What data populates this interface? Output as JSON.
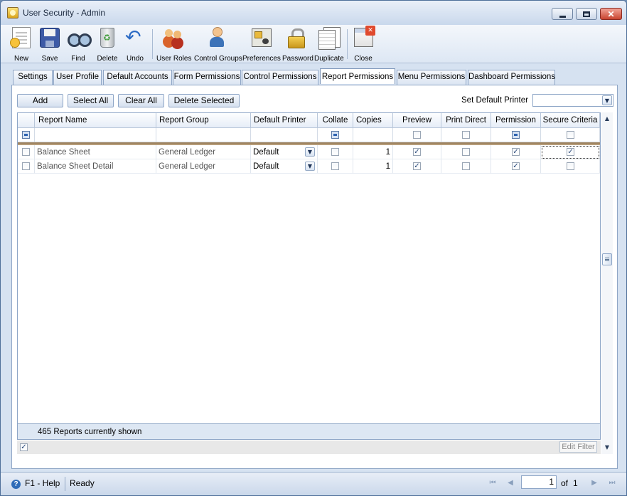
{
  "window": {
    "title": "User Security - Admin"
  },
  "toolbar": {
    "new": "New",
    "save": "Save",
    "find": "Find",
    "delete": "Delete",
    "undo": "Undo",
    "user_roles": "User Roles",
    "control_groups": "Control Groups",
    "preferences": "Preferences",
    "password": "Password",
    "duplicate": "Duplicate",
    "close": "Close"
  },
  "tabs": [
    "Settings",
    "User Profile",
    "Default Accounts",
    "Form Permissions",
    "Control Permissions",
    "Report Permissions",
    "Menu Permissions",
    "Dashboard Permissions"
  ],
  "active_tab": "Report Permissions",
  "actions": {
    "add": "Add",
    "select_all": "Select All",
    "clear_all": "Clear All",
    "delete_selected": "Delete Selected"
  },
  "default_printer": {
    "label": "Set Default Printer",
    "value": ""
  },
  "grid": {
    "columns": [
      "Report Name",
      "Report Group",
      "Default Printer",
      "Collate",
      "Copies",
      "Preview",
      "Print Direct",
      "Permission",
      "Secure Criteria"
    ],
    "rows": [
      {
        "name": "Balance Sheet",
        "group": "General Ledger",
        "printer": "Default",
        "collate": false,
        "copies": "1",
        "preview": true,
        "print_direct": false,
        "permission": true,
        "secure_criteria": true
      },
      {
        "name": "Balance Sheet Detail",
        "group": "General Ledger",
        "printer": "Default",
        "collate": false,
        "copies": "1",
        "preview": true,
        "print_direct": false,
        "permission": true,
        "secure_criteria": false
      }
    ],
    "footer": "465 Reports currently shown"
  },
  "edit_filter": "Edit Filter",
  "status": {
    "help": "F1 - Help",
    "state": "Ready",
    "page": "1",
    "of_label": "of",
    "total_pages": "1"
  },
  "colors": {
    "accent": "#2f6cb8",
    "window_frame": "#4e6f99",
    "header_bg": "#e6edf7"
  }
}
